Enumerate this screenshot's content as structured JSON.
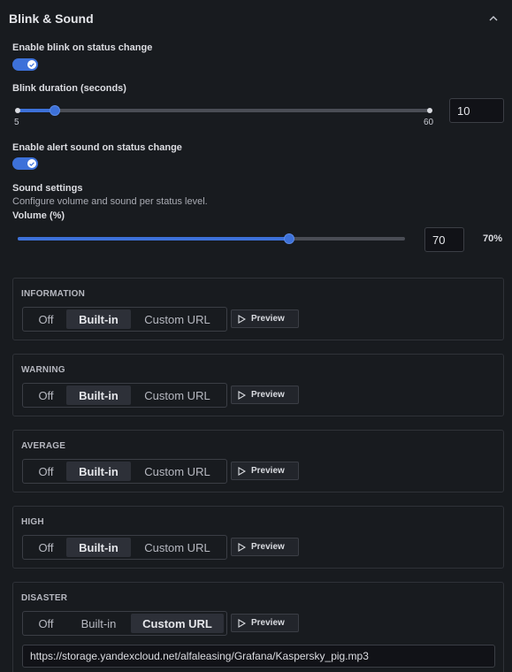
{
  "header": {
    "title": "Blink & Sound",
    "collapse_icon": "chevron-up-icon"
  },
  "blink": {
    "enable_label": "Enable blink on status change",
    "enabled": true,
    "duration_label": "Blink duration (seconds)",
    "min_label": "5",
    "max_label": "60",
    "min": 5,
    "max": 60,
    "value": 10,
    "value_text": "10"
  },
  "alert": {
    "enable_label": "Enable alert sound on status change",
    "enabled": true
  },
  "sound": {
    "title": "Sound settings",
    "description": "Configure volume and sound per status level.",
    "volume_label": "Volume (%)",
    "volume": 70,
    "volume_text": "70",
    "volume_pct": "70%"
  },
  "panels": [
    {
      "title": "INFORMATION",
      "options": [
        "Off",
        "Built-in",
        "Custom URL"
      ],
      "selected": "Built-in",
      "preview": "Preview"
    },
    {
      "title": "WARNING",
      "options": [
        "Off",
        "Built-in",
        "Custom URL"
      ],
      "selected": "Built-in",
      "preview": "Preview"
    },
    {
      "title": "AVERAGE",
      "options": [
        "Off",
        "Built-in",
        "Custom URL"
      ],
      "selected": "Built-in",
      "preview": "Preview"
    },
    {
      "title": "HIGH",
      "options": [
        "Off",
        "Built-in",
        "Custom URL"
      ],
      "selected": "Built-in",
      "preview": "Preview"
    },
    {
      "title": "DISASTER",
      "options": [
        "Off",
        "Built-in",
        "Custom URL"
      ],
      "selected": "Custom URL",
      "preview": "Preview",
      "url": "https://storage.yandexcloud.net/alfaleasing/Grafana/Kaspersky_pig.mp3"
    }
  ],
  "colors": {
    "accent": "#3d71d9",
    "background": "#181b1f",
    "border": "#2f3238"
  }
}
